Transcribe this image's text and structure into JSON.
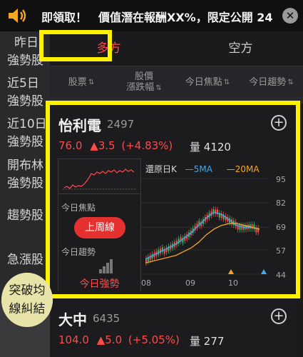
{
  "announcement": {
    "icon": "speaker-icon",
    "text": "即領取！　價值潛在報酬XX%，限定公開 24",
    "close_icon": "close-icon"
  },
  "tabs": {
    "long": "多方",
    "short": "空方"
  },
  "columns": {
    "stock": "股票",
    "change_line1": "股價",
    "change_line2": "漲跌幅",
    "focus": "今日焦點",
    "trend": "今日趨勢",
    "sort_icon": "sort-icon"
  },
  "sidebar": {
    "items": [
      {
        "line1": "昨日",
        "line2": "強勢股"
      },
      {
        "line1": "近5日",
        "line2": "強勢股"
      },
      {
        "line1": "近10日",
        "line2": "強勢股"
      },
      {
        "line1": "開布林",
        "line2": "強勢股"
      },
      {
        "line1": "趨勢股",
        "line2": ""
      },
      {
        "line1": "急漲股",
        "line2": ""
      }
    ],
    "active": {
      "line1": "突破均",
      "line2": "線糾結"
    }
  },
  "card": {
    "name": "怡利電",
    "code": "2497",
    "price": "76.0",
    "change": "▲3.5",
    "change_pct": "(+4.83%)",
    "volume_label": "量",
    "volume": "4120",
    "focus_label": "今日焦點",
    "focus_value": "上周線",
    "trend_label": "今日趨勢",
    "trend_value": "今日強勢",
    "chart_legend": {
      "restored": "還原日K",
      "ma5": "5MA",
      "ma20": "20MA"
    },
    "y_ticks": [
      "95",
      "82",
      "69",
      "57",
      "44"
    ],
    "x_ticks": [
      "08",
      "09",
      "10"
    ],
    "colors": {
      "up": "#ff4a4a",
      "down": "#2bbf6a",
      "ma5": "#3fa9f5",
      "ma20": "#f5a623"
    }
  },
  "card2": {
    "name": "大中",
    "code": "6435",
    "price": "104.0",
    "change": "▲5.0",
    "change_pct": "(+5.05%)",
    "volume_label": "量",
    "volume": "277"
  },
  "chart_data": {
    "type": "line",
    "title": "",
    "series": [
      {
        "name": "5MA",
        "values": [
          52,
          54,
          56,
          58,
          60,
          63,
          66,
          70,
          74,
          77,
          76,
          73,
          70,
          69,
          69,
          68
        ]
      },
      {
        "name": "20MA",
        "values": [
          50,
          51,
          52,
          53,
          54,
          56,
          58,
          61,
          65,
          68,
          70,
          71,
          71,
          70,
          69,
          68
        ]
      }
    ],
    "ylim": [
      44,
      95
    ],
    "y_ticks": [
      95,
      82,
      69,
      57,
      44
    ],
    "x_ticks": [
      "08",
      "09",
      "10"
    ]
  }
}
